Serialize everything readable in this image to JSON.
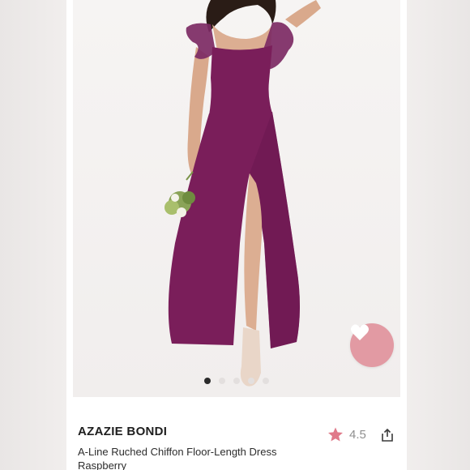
{
  "listing": {
    "brand": "AZAZIE BONDI",
    "title_line1": "A-Line Ruched Chiffon Floor-Length Dress",
    "title_line2": "Raspberry",
    "rating": "4.5"
  },
  "carousel": {
    "slide_count": 5,
    "active_index": 0
  },
  "icons": {
    "favorite": "heart-icon",
    "rating": "star-icon",
    "share": "share-icon"
  },
  "colors": {
    "dress": "#7a1e5a",
    "favorite_button": "#e29aa3",
    "star": "#e07a8a"
  }
}
